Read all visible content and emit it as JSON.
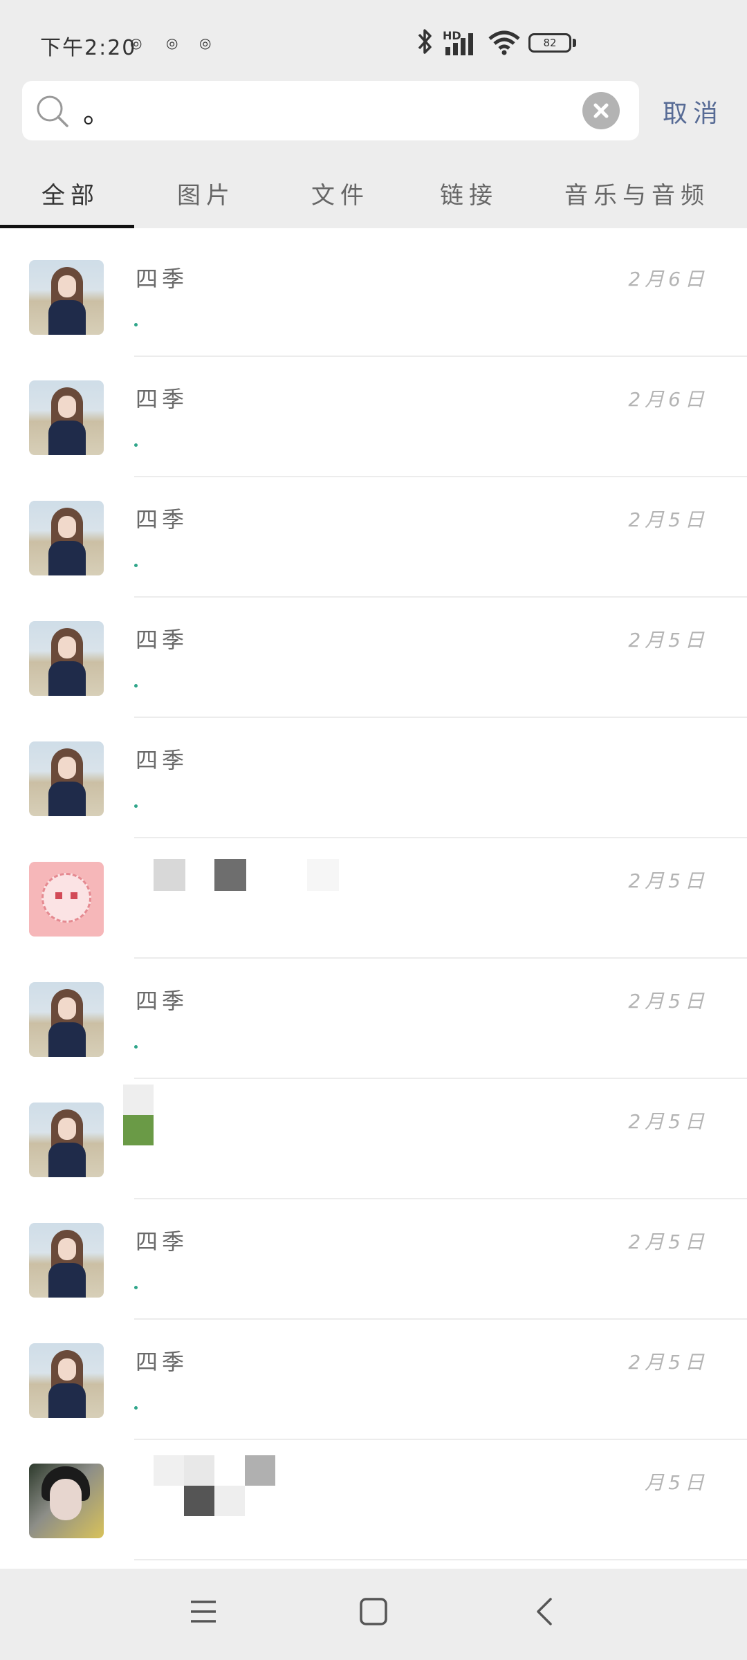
{
  "status_bar": {
    "time": "下午2:20",
    "network_label": "HD",
    "battery": "82",
    "icons": [
      "eye-icon",
      "eye-icon",
      "eye-icon",
      "bluetooth-icon",
      "signal-icon",
      "wifi-icon",
      "battery-icon"
    ]
  },
  "search": {
    "value": "。",
    "cancel_label": "取消",
    "icons": [
      "search-icon",
      "clear-icon"
    ]
  },
  "tabs": [
    {
      "label": "全部",
      "active": true
    },
    {
      "label": "图片",
      "active": false
    },
    {
      "label": "文件",
      "active": false
    },
    {
      "label": "链接",
      "active": false
    },
    {
      "label": "音乐与音频",
      "active": false
    }
  ],
  "results": [
    {
      "name": "四季",
      "date": "2月6日",
      "snippet": "。"
    },
    {
      "name": "四季",
      "date": "2月6日",
      "snippet": "。"
    },
    {
      "name": "四季",
      "date": "2月5日",
      "snippet": "。"
    },
    {
      "name": "四季",
      "date": "2月5日",
      "snippet": "。"
    },
    {
      "name": "四季",
      "date": "",
      "snippet": "。"
    },
    {
      "name": "",
      "date": "2月5日",
      "snippet": ""
    },
    {
      "name": "四季",
      "date": "2月5日",
      "snippet": "。"
    },
    {
      "name": "",
      "date": "2月5日",
      "snippet": ""
    },
    {
      "name": "四季",
      "date": "2月5日",
      "snippet": "。"
    },
    {
      "name": "四季",
      "date": "2月5日",
      "snippet": "。"
    },
    {
      "name": "",
      "date": "月5日",
      "snippet": ""
    }
  ],
  "nav": {
    "icons": [
      "menu-icon",
      "home-icon",
      "back-icon"
    ]
  }
}
